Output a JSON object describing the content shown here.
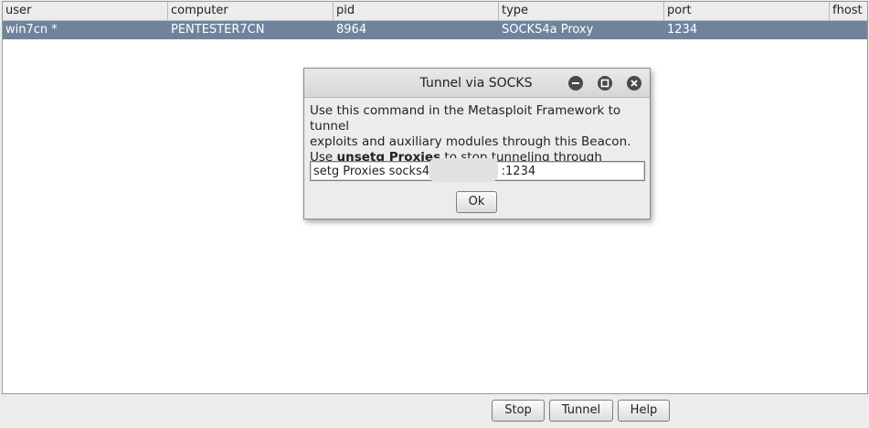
{
  "table": {
    "columns": [
      "user",
      "computer",
      "pid",
      "type",
      "port",
      "fhost"
    ],
    "rows": [
      {
        "user": "win7cn *",
        "computer": "PENTESTER7CN",
        "pid": "8964",
        "type": "SOCKS4a Proxy",
        "port": "1234",
        "fhost": ""
      }
    ]
  },
  "dialog": {
    "title": "Tunnel via SOCKS",
    "line1": "Use this command in the Metasploit Framework to tunnel",
    "line2": "exploits and auxiliary modules through this Beacon.",
    "line3_prefix": "Use ",
    "line3_bold": "unsetg Proxies",
    "line3_suffix": " to stop tunneling through Beacon.",
    "command_value": "setg Proxies socks4                   :1234",
    "ok_label": "Ok",
    "window_icons": [
      "minimize-icon",
      "maximize-icon",
      "close-icon"
    ]
  },
  "bottom_buttons": {
    "stop_label": "Stop",
    "tunnel_label": "Tunnel",
    "help_label": "Help"
  },
  "colors": {
    "selected_row": "#6f849c",
    "background": "#ececec"
  }
}
